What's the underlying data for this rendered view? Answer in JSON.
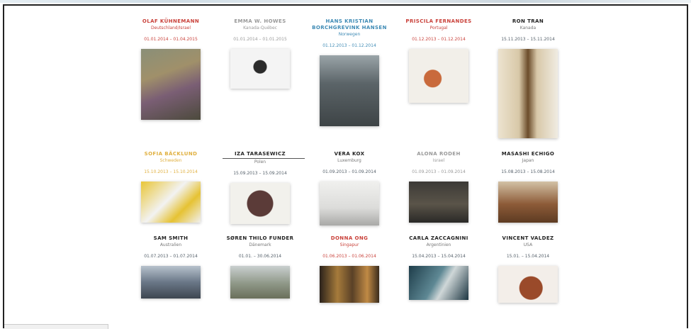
{
  "artists": [
    [
      {
        "name": "OLAF KÜHNEMANN",
        "country": "Deutschland/Israel",
        "dates": "01.01.2014 – 01.04.2015",
        "color": "#c9413a",
        "thumb": "painting"
      },
      {
        "name": "EMMA W. HOWES",
        "country": "Kanada-Québec",
        "dates": "01.01.2014 – 01.01.2015",
        "color": "#999999",
        "thumb": "object"
      },
      {
        "name": "HANS KRISTIAN BORCHGREVINK HANSEN",
        "country": "Norwegen",
        "dates": "01.12.2013 – 01.12.2014",
        "color": "#3f8bb5",
        "thumb": "room"
      },
      {
        "name": "PRISCILA FERNANDES",
        "country": "Portugal",
        "dates": "01.12.2013 – 01.12.2014",
        "color": "#c9413a",
        "thumb": "child"
      },
      {
        "name": "RON TRAN",
        "country": "Kanada",
        "dates": "15.11.2013 – 15.11.2014",
        "color": "#222222",
        "thumb": "hallway"
      }
    ],
    [
      {
        "name": "SOFIA BÄCKLUND",
        "country": "Schweden",
        "dates": "15.10.2013 – 15.10.2014",
        "color": "#e0b040",
        "thumb": "yellow"
      },
      {
        "name": "IZA TARASEWICZ",
        "country": "Polen",
        "dates": "15.09.2013 – 15.09.2014",
        "color": "#222222",
        "thumb": "circle",
        "active": true
      },
      {
        "name": "VERA KOX",
        "country": "Luxemburg",
        "dates": "01.09.2013 – 01.09.2014",
        "color": "#222222",
        "thumb": "gallery"
      },
      {
        "name": "ALONA RODEH",
        "country": "Israel",
        "dates": "01.09.2013 – 01.09.2014",
        "color": "#999999",
        "thumb": "dark"
      },
      {
        "name": "MASASHI ECHIGO",
        "country": "Japan",
        "dates": "15.08.2013 – 15.08.2014",
        "color": "#222222",
        "thumb": "wood"
      }
    ],
    [
      {
        "name": "SAM SMITH",
        "country": "Australien",
        "dates": "01.07.2013 – 01.07.2014",
        "color": "#222222",
        "thumb": "landscape"
      },
      {
        "name": "SØREN THILO FUNDER",
        "country": "Dänemark",
        "dates": "01.01. – 30.06.2014",
        "color": "#222222",
        "thumb": "fighters"
      },
      {
        "name": "DONNA ONG",
        "country": "Singapur",
        "dates": "01.06.2013 – 01.06.2014",
        "color": "#c9413a",
        "thumb": "boxes"
      },
      {
        "name": "CARLA ZACCAGNINI",
        "country": "Argentinien",
        "dates": "15.04.2013 – 15.04.2014",
        "color": "#222222",
        "thumb": "teal"
      },
      {
        "name": "VINCENT VALDEZ",
        "country": "USA",
        "dates": "15.01. – 15.04.2014",
        "color": "#222222",
        "thumb": "portrait"
      }
    ]
  ]
}
